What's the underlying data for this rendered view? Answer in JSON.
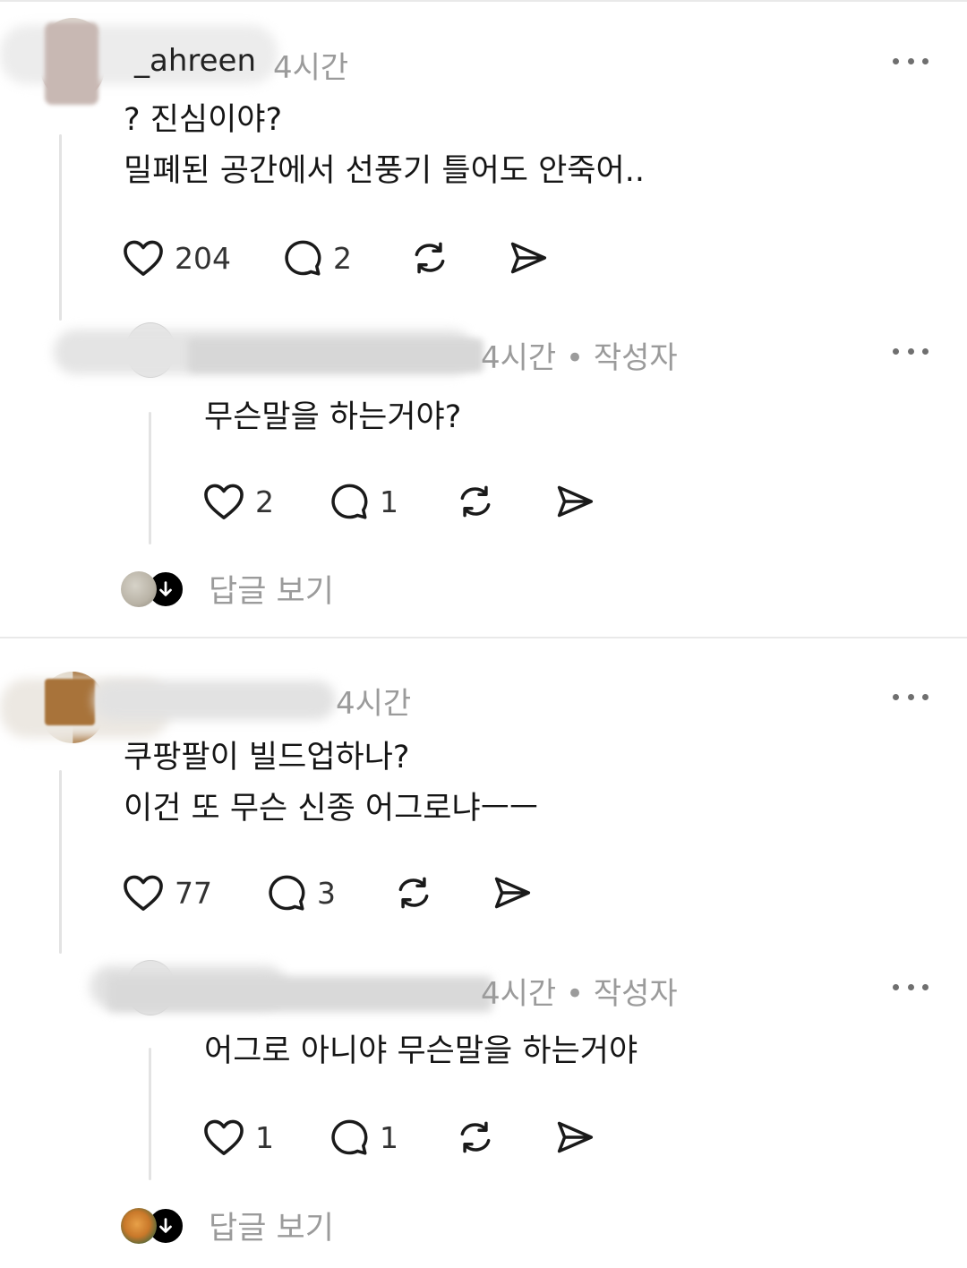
{
  "posts": [
    {
      "username_partial": "_ahreen",
      "time": "4시간",
      "lines": [
        "? 진심이야?",
        "밀폐된 공간에서 선풍기 틀어도 안죽어.."
      ],
      "likes": "204",
      "comments": "2",
      "reply": {
        "meta": "4시간 • 작성자",
        "text": "무슨말을 하는거야?",
        "likes": "2",
        "comments": "1"
      },
      "view_replies": "답글 보기"
    },
    {
      "time": "4시간",
      "lines": [
        "쿠팡팔이 빌드업하나?",
        "이건 또 무슨 신종 어그로냐ㅡㅡ"
      ],
      "likes": "77",
      "comments": "3",
      "reply": {
        "meta": "4시간 • 작성자",
        "text": "어그로 아니야 무슨말을 하는거야",
        "likes": "1",
        "comments": "1"
      },
      "view_replies": "답글 보기"
    }
  ],
  "icons": {
    "like": "heart-icon",
    "comment": "comment-bubble-icon",
    "repost": "repost-icon",
    "share": "send-icon",
    "more": "more-options-icon",
    "expand": "arrow-down-icon"
  }
}
